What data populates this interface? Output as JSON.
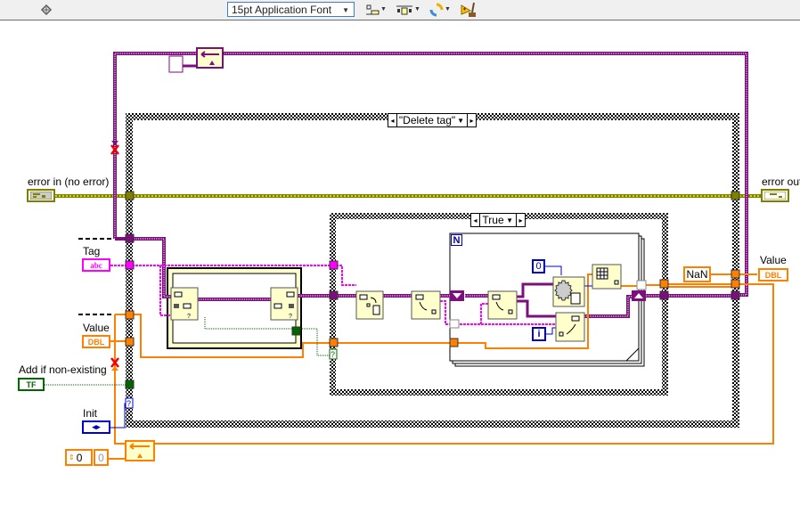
{
  "toolbar": {
    "run_icon": "clean-up-diagram-icon",
    "font_select": "15pt Application Font",
    "align_icon": "align-objects-icon",
    "distribute_icon": "distribute-objects-icon",
    "reorder_icon": "reorder-icon",
    "cleanup_icon": "clean-up-wiring-icon"
  },
  "controls": {
    "error_in": {
      "label": "error in (no error)",
      "type": "error-cluster"
    },
    "tag": {
      "label": "Tag",
      "type_text": "abc"
    },
    "value_in": {
      "label": "Value",
      "type_text": "DBL"
    },
    "add_if_non_existing": {
      "label": "Add if non-existing",
      "type_text": "TF"
    },
    "init": {
      "label": "Init",
      "type_text": "◂▸"
    },
    "numeric_zero": {
      "value": "0"
    }
  },
  "indicators": {
    "error_out": {
      "label": "error out",
      "type": "error-cluster"
    },
    "value_out": {
      "label": "Value",
      "type_text": "DBL"
    }
  },
  "structures": {
    "outer_case": {
      "selector": "\"Delete tag\""
    },
    "inner_case": {
      "selector": "True"
    },
    "for_loop": {
      "count_terminal": "N",
      "iteration_terminal": "i"
    }
  },
  "constants": {
    "nan": "NaN",
    "index_zero": "0",
    "shift_reg_init": "0"
  },
  "colors": {
    "error_wire": "#7f7f00",
    "class_wire": "#7d0e7d",
    "string_wire": "#ff00ff",
    "dbl_wire": "#ff7f00",
    "bool_wire": "#006600",
    "enum_wire": "#0000cc",
    "node_fill": "#ffffcc"
  }
}
